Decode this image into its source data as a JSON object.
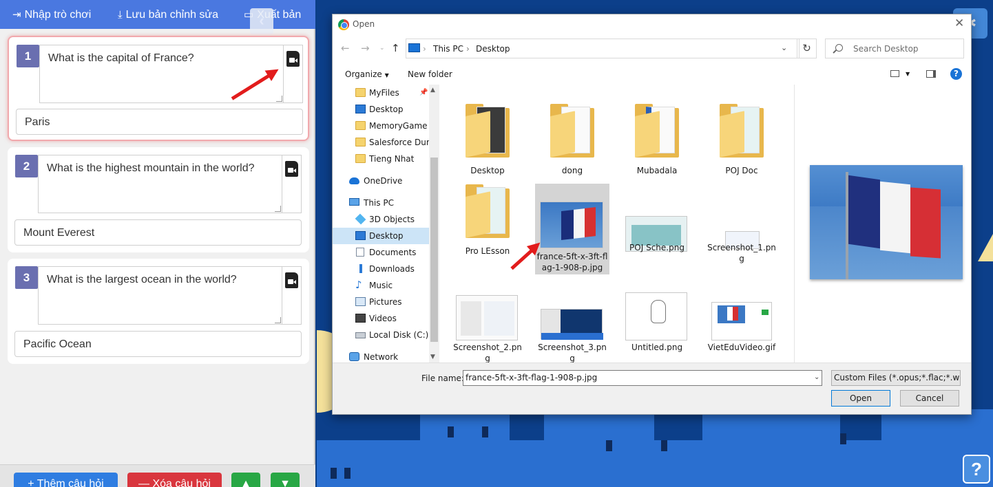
{
  "editor": {
    "toolbar": {
      "import_label": "Nhập trò chơi",
      "save_label": "Lưu bản chỉnh sửa",
      "export_label": "Xuất bản"
    },
    "questions": [
      {
        "number": "1",
        "question": "What is the capital of France?",
        "answer": "Paris"
      },
      {
        "number": "2",
        "question": "What is the highest mountain in the world?",
        "answer": "Mount Everest"
      },
      {
        "number": "3",
        "question": "What is the largest ocean in the world?",
        "answer": "Pacific Ocean"
      }
    ],
    "bottom": {
      "add_label": "Thêm câu hỏi",
      "delete_label": "Xóa câu hỏi"
    }
  },
  "help_button": "?",
  "dialog": {
    "title": "Open",
    "breadcrumb": [
      "This PC",
      "Desktop"
    ],
    "search_placeholder": "Search Desktop",
    "organize_label": "Organize",
    "new_folder_label": "New folder",
    "nav_items": [
      {
        "label": "MyFiles",
        "icon": "folder-icon",
        "pinned": true
      },
      {
        "label": "Desktop",
        "icon": "desktop-icon"
      },
      {
        "label": "MemoryGame",
        "icon": "folder-icon"
      },
      {
        "label": "Salesforce Dump",
        "icon": "folder-icon"
      },
      {
        "label": "Tieng Nhat",
        "icon": "folder-icon"
      },
      {
        "label": "OneDrive",
        "icon": "cloud-icon"
      },
      {
        "label": "This PC",
        "icon": "computer-icon"
      },
      {
        "label": "3D Objects",
        "icon": "cube-icon"
      },
      {
        "label": "Desktop",
        "icon": "desktop-icon",
        "selected": true
      },
      {
        "label": "Documents",
        "icon": "document-icon"
      },
      {
        "label": "Downloads",
        "icon": "download-icon"
      },
      {
        "label": "Music",
        "icon": "music-icon"
      },
      {
        "label": "Pictures",
        "icon": "pictures-icon"
      },
      {
        "label": "Videos",
        "icon": "videos-icon"
      },
      {
        "label": "Local Disk (C:)",
        "icon": "disk-icon"
      },
      {
        "label": "Network",
        "icon": "network-icon"
      }
    ],
    "files": [
      {
        "name": "Desktop",
        "kind": "folder"
      },
      {
        "name": "dong",
        "kind": "folder"
      },
      {
        "name": "Mubadala",
        "kind": "folder"
      },
      {
        "name": "POJ Doc",
        "kind": "folder"
      },
      {
        "name": "Pro LEsson",
        "kind": "folder"
      },
      {
        "name": "france-5ft-x-3ft-flag-1-908-p.jpg",
        "kind": "image",
        "selected": true
      },
      {
        "name": "POJ Sche.png",
        "kind": "image"
      },
      {
        "name": "Screenshot_1.png",
        "kind": "image"
      },
      {
        "name": "Screenshot_2.png",
        "kind": "image"
      },
      {
        "name": "Screenshot_3.png",
        "kind": "image"
      },
      {
        "name": "Untitled.png",
        "kind": "image"
      },
      {
        "name": "VietEduVideo.gif",
        "kind": "image"
      }
    ],
    "file_name_label": "File name:",
    "file_name_value": "france-5ft-x-3ft-flag-1-908-p.jpg",
    "filter_value": "Custom Files (*.opus;*.flac;*.we",
    "open_label": "Open",
    "cancel_label": "Cancel"
  },
  "colors": {
    "toolbar": "#4a78e0",
    "question_badge": "#6a6fb0",
    "add_button": "#2f7de1",
    "delete_button": "#d9363e",
    "move_button": "#28a745",
    "annotation_arrow": "#e21c1c",
    "selection": "#cce4f7"
  }
}
